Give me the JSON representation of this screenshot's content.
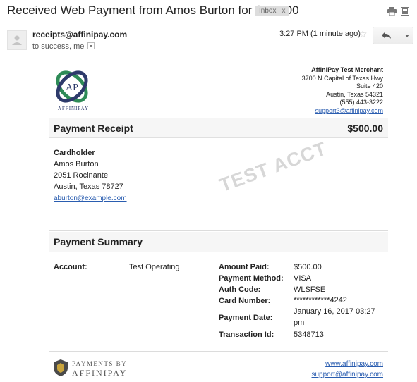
{
  "email": {
    "subject": "Received Web Payment from Amos Burton for $500.00",
    "label": "Inbox",
    "label_remove": "x",
    "sender": "receipts@affinipay.com",
    "recipients": "to success, me",
    "timestamp": "3:27 PM (1 minute ago)"
  },
  "merchant": {
    "logo_initials": "AP",
    "logo_name": "AFFINIPAY",
    "name": "AffiniPay Test Merchant",
    "address1": "3700 N Capital of Texas Hwy",
    "address2": "Suite 420",
    "city": "Austin, Texas 54321",
    "phone": "(555) 443-3222",
    "email": "support3@affinipay.com"
  },
  "receipt": {
    "title": "Payment Receipt",
    "amount": "$500.00",
    "watermark": "TEST ACCT"
  },
  "cardholder": {
    "heading": "Cardholder",
    "name": "Amos Burton",
    "street": "2051 Rocinante",
    "city": "Austin, Texas 78727",
    "email": "aburton@example.com"
  },
  "summary": {
    "title": "Payment Summary",
    "account_label": "Account:",
    "account_value": "Test Operating",
    "amount_paid_label": "Amount Paid:",
    "amount_paid_value": "$500.00",
    "method_label": "Payment Method:",
    "method_value": "VISA",
    "auth_label": "Auth Code:",
    "auth_value": "WLSFSE",
    "card_label": "Card Number:",
    "card_value": "************4242",
    "date_label": "Payment Date:",
    "date_value_line1": "January 16, 2017 03:27",
    "date_value_line2": "pm",
    "txn_label": "Transaction Id:",
    "txn_value": "5348713"
  },
  "footer": {
    "brand_line1": "PAYMENTS BY",
    "brand_line2": "AFFINIPAY",
    "website": "www.affinipay.com",
    "support": "support@affinipay.com"
  },
  "colors": {
    "link": "#2a5db0",
    "logo_green": "#2e8b57",
    "logo_navy": "#2d3a6b",
    "watermark": "#d7d7d7",
    "bar_bg": "#f6f6f6"
  },
  "icons": [
    "print-icon",
    "popout-icon",
    "avatar-icon",
    "star-icon",
    "reply-icon",
    "more-options-icon",
    "affinipay-logo",
    "footer-shield-icon"
  ]
}
